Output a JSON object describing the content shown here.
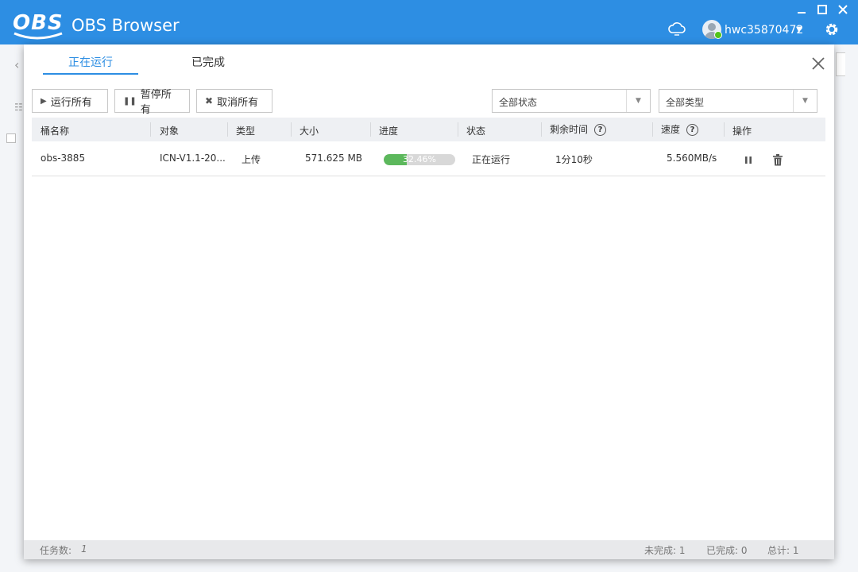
{
  "app": {
    "logo": "OBS",
    "name": "OBS Browser",
    "username": "hwc35870472"
  },
  "tabs": [
    {
      "label": "正在运行",
      "active": true
    },
    {
      "label": "已完成",
      "active": false
    }
  ],
  "toolbar": {
    "run_all": "运行所有",
    "pause_all": "暂停所有",
    "cancel_all": "取消所有"
  },
  "filters": {
    "status": "全部状态",
    "type": "全部类型"
  },
  "table": {
    "columns": [
      "桶名称",
      "对象",
      "类型",
      "大小",
      "进度",
      "状态",
      "剩余时间",
      "速度",
      "操作"
    ],
    "rows": [
      {
        "bucket": "obs-3885",
        "object": "ICN-V1.1-20...",
        "type": "上传",
        "size": "571.625 MB",
        "progress": 32.46,
        "progress_label": "32.46%",
        "status": "正在运行",
        "remaining": "1分10秒",
        "speed": "5.560MB/s"
      }
    ]
  },
  "footer": {
    "task_count_label": "任务数:",
    "task_count": "1",
    "incomplete": "未完成: 1",
    "completed": "已完成: 0",
    "total": "总计: 1"
  },
  "colors": {
    "accent": "#2d8ee3",
    "progress": "#5cb85c"
  }
}
